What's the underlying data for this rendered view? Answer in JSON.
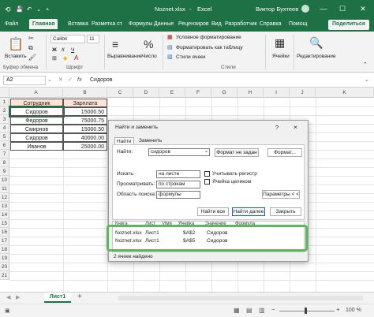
{
  "titlebar": {
    "autosave": "",
    "filename": "Noznet.xlsx",
    "sep": "-",
    "app": "Excel",
    "user": "Виктор Бухтеев"
  },
  "tabs": [
    "Файл",
    "Главная",
    "Вставка",
    "Разметка ст",
    "Формулы",
    "Данные",
    "Рецензиров",
    "Вид",
    "Разработчик",
    "Справка",
    "Помощ",
    "Поделиться"
  ],
  "ribbon": {
    "groups": {
      "clipboard": "Буфер обмена",
      "font": "Шрифт",
      "styles": "Стили",
      "cells": "Ячейки",
      "editing": "Редактирование"
    },
    "paste": "Вставить",
    "font_name": "Calibri",
    "font_size": "11",
    "bold": "Ж",
    "italic": "К",
    "underline": "Ч",
    "cond_format": "Условное форматирование",
    "format_table": "Форматировать как таблицу",
    "cell_styles": "Стили ячеек",
    "alignment": "Выравнивание",
    "number": "Число",
    "percent": "%"
  },
  "formula_bar": {
    "name_box": "A2",
    "fx": "fx",
    "value": "Сидоров"
  },
  "grid": {
    "columns": [
      "A",
      "B",
      "C",
      "D",
      "E",
      "F",
      "G",
      "H",
      "I",
      "J",
      "K"
    ],
    "rows": [
      "1",
      "2",
      "3",
      "4",
      "5",
      "6",
      "7",
      "8",
      "9",
      "10",
      "11",
      "12",
      "13",
      "14",
      "15",
      "16",
      "17",
      "18",
      "19",
      "20",
      "21"
    ],
    "headers": [
      "Сотрудник",
      "Зарплата"
    ],
    "data": [
      [
        "Сидоров",
        "15000.50"
      ],
      [
        "Федоров",
        "75000.75"
      ],
      [
        "Смирнов",
        "15000.50"
      ],
      [
        "Сидоров",
        "40000.00"
      ],
      [
        "Иванов",
        "25000.00"
      ]
    ]
  },
  "sheet": {
    "name": "Лист1",
    "add": "+"
  },
  "status": {
    "zoom": "100 %"
  },
  "dialog": {
    "title": "Найти и заменить",
    "help": "?",
    "close": "×",
    "tab_find": "Найти",
    "tab_replace": "Заменить",
    "find_label": "Найти:",
    "find_value": "сидоров",
    "format_status": "Формат не задан",
    "format_btn": "Формат...",
    "within_label": "Искать:",
    "within_value": "на листе",
    "search_label": "Просматривать:",
    "search_value": "по строкам",
    "lookin_label": "Область поиска:",
    "lookin_value": "формулы",
    "match_case": "Учитывать регистр",
    "match_entire": "Ячейка целиком",
    "options_btn": "Параметры < <",
    "find_all": "Найти все",
    "find_next": "Найти далее",
    "close_btn": "Закрыть",
    "results_headers": [
      "Книга",
      "Лист",
      "Имя",
      "Ячейка",
      "Значение",
      "Формула"
    ],
    "results": [
      [
        "Noznet.xlsx",
        "Лист1",
        "",
        "$A$2",
        "Сидоров",
        ""
      ],
      [
        "Noznet.xlsx",
        "Лист1",
        "",
        "$A$5",
        "Сидоров",
        ""
      ]
    ],
    "found_status": "2 ячеек найдено"
  },
  "colors": {
    "excel_green": "#1e7145",
    "highlight": "#5cb85c",
    "header_fill": "#fce4d6"
  }
}
